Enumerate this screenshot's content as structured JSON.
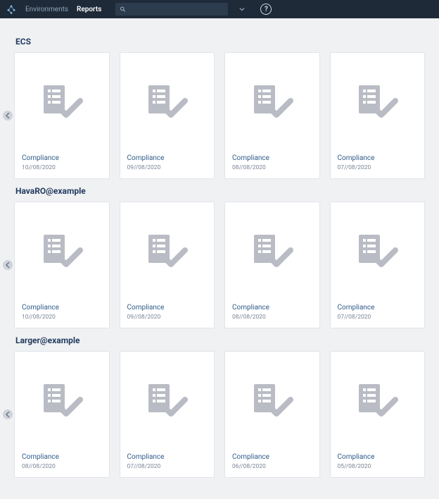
{
  "nav": {
    "environments": "Environments",
    "reports": "Reports"
  },
  "search": {
    "placeholder": ""
  },
  "help_glyph": "?",
  "sections": [
    {
      "title": "ECS",
      "cards": [
        {
          "title": "Compliance",
          "date": "10//08/2020"
        },
        {
          "title": "Compliance",
          "date": "09//08/2020"
        },
        {
          "title": "Compliance",
          "date": "08//08/2020"
        },
        {
          "title": "Compliance",
          "date": "07//08/2020"
        }
      ]
    },
    {
      "title": "HavaRO@example",
      "cards": [
        {
          "title": "Compliance",
          "date": "10//08/2020"
        },
        {
          "title": "Compliance",
          "date": "09//08/2020"
        },
        {
          "title": "Compliance",
          "date": "08//08/2020"
        },
        {
          "title": "Compliance",
          "date": "07//08/2020"
        }
      ]
    },
    {
      "title": "Larger@example",
      "cards": [
        {
          "title": "Compliance",
          "date": "08//08/2020"
        },
        {
          "title": "Compliance",
          "date": "07//08/2020"
        },
        {
          "title": "Compliance",
          "date": "06//08/2020"
        },
        {
          "title": "Compliance",
          "date": "05//08/2020"
        }
      ]
    }
  ]
}
